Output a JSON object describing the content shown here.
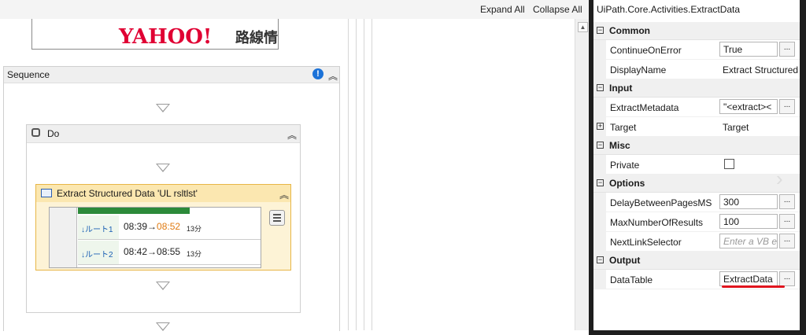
{
  "toolbar": {
    "expand_all": "Expand All",
    "collapse_all": "Collapse All"
  },
  "designer": {
    "banner": {
      "logo_text": "YAHOO!",
      "jp_text": "路線情"
    },
    "sequence": {
      "title": "Sequence",
      "warn_symbol": "!"
    },
    "do": {
      "title": "Do"
    },
    "extract": {
      "title": "Extract Structured Data 'UL  rsltlst'",
      "preview_rows": [
        {
          "route": "↓ルート1",
          "time_start": "08:39→",
          "time_end": "08:52",
          "duration": "13分"
        },
        {
          "route": "↓ルート2",
          "time_start": "08:42→08:55",
          "time_end": "",
          "duration": "13分"
        }
      ]
    }
  },
  "properties": {
    "title": "UiPath.Core.Activities.ExtractData",
    "categories": {
      "common": "Common",
      "input": "Input",
      "misc": "Misc",
      "options": "Options",
      "output": "Output"
    },
    "rows": {
      "continue_on_error": {
        "name": "ContinueOnError",
        "value": "True"
      },
      "display_name": {
        "name": "DisplayName",
        "value": "Extract Structured Data"
      },
      "extract_metadata": {
        "name": "ExtractMetadata",
        "value": "\"<extract><"
      },
      "target": {
        "name": "Target",
        "value": "Target"
      },
      "private": {
        "name": "Private",
        "checked": false
      },
      "delay": {
        "name": "DelayBetweenPagesMS",
        "value": "300"
      },
      "max_results": {
        "name": "MaxNumberOfResults",
        "value": "100"
      },
      "next_link": {
        "name": "NextLinkSelector",
        "placeholder": "Enter a VB e"
      },
      "data_table": {
        "name": "DataTable",
        "value": "ExtractData"
      }
    },
    "ellipsis": "...",
    "accent_red": "#e0141e"
  }
}
